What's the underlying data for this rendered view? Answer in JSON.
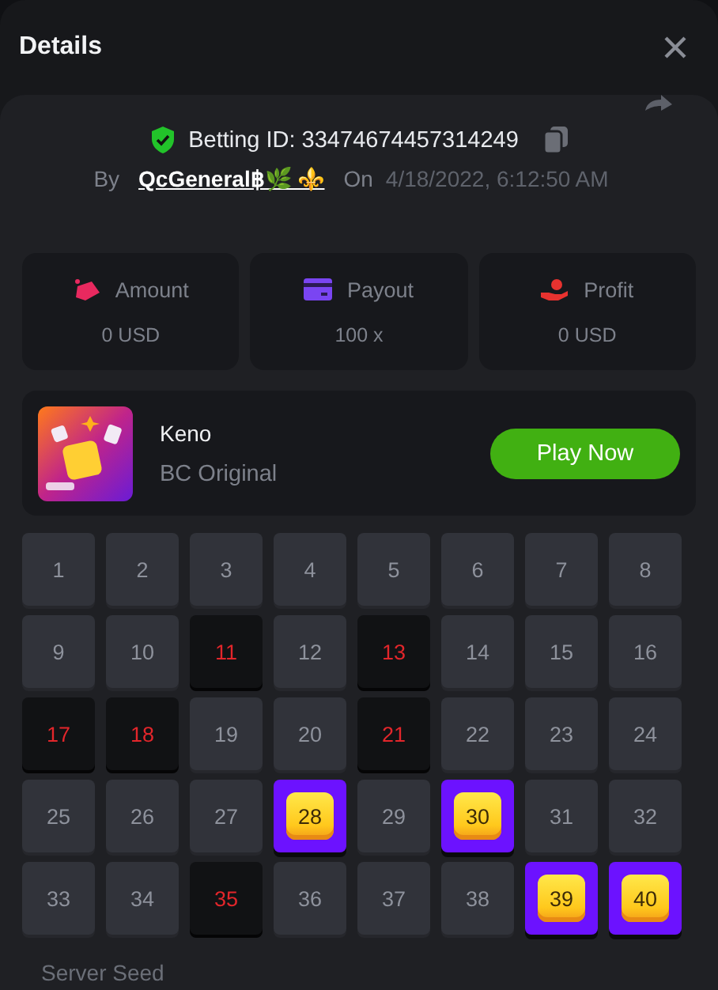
{
  "dialog": {
    "title": "Details"
  },
  "bet": {
    "betting_id": "Betting ID: 33474674457314249",
    "by_label": "By",
    "user": "QcGeneral฿🌿 ⚜️",
    "on_label": "On",
    "date": "4/18/2022, 6:12:50 AM"
  },
  "stats": [
    {
      "kind": "amount",
      "label": "Amount",
      "value": "0 USD"
    },
    {
      "kind": "payout",
      "label": "Payout",
      "value": "100 x"
    },
    {
      "kind": "profit",
      "label": "Profit",
      "value": "0 USD"
    }
  ],
  "game": {
    "name": "Keno",
    "provider": "BC Original",
    "button": "Play Now"
  },
  "cells": [
    {
      "number": "1",
      "kind": "normal"
    },
    {
      "number": "2",
      "kind": "normal"
    },
    {
      "number": "3",
      "kind": "normal"
    },
    {
      "number": "4",
      "kind": "normal"
    },
    {
      "number": "5",
      "kind": "normal"
    },
    {
      "number": "6",
      "kind": "normal"
    },
    {
      "number": "7",
      "kind": "normal"
    },
    {
      "number": "8",
      "kind": "normal"
    },
    {
      "number": "9",
      "kind": "normal"
    },
    {
      "number": "10",
      "kind": "normal"
    },
    {
      "number": "11",
      "kind": "miss"
    },
    {
      "number": "12",
      "kind": "normal"
    },
    {
      "number": "13",
      "kind": "miss"
    },
    {
      "number": "14",
      "kind": "normal"
    },
    {
      "number": "15",
      "kind": "normal"
    },
    {
      "number": "16",
      "kind": "normal"
    },
    {
      "number": "17",
      "kind": "miss"
    },
    {
      "number": "18",
      "kind": "miss"
    },
    {
      "number": "19",
      "kind": "normal"
    },
    {
      "number": "20",
      "kind": "normal"
    },
    {
      "number": "21",
      "kind": "miss"
    },
    {
      "number": "22",
      "kind": "normal"
    },
    {
      "number": "23",
      "kind": "normal"
    },
    {
      "number": "24",
      "kind": "normal"
    },
    {
      "number": "25",
      "kind": "normal"
    },
    {
      "number": "26",
      "kind": "normal"
    },
    {
      "number": "27",
      "kind": "normal"
    },
    {
      "number": "28",
      "kind": "hit"
    },
    {
      "number": "29",
      "kind": "normal"
    },
    {
      "number": "30",
      "kind": "hit"
    },
    {
      "number": "31",
      "kind": "normal"
    },
    {
      "number": "32",
      "kind": "normal"
    },
    {
      "number": "33",
      "kind": "normal"
    },
    {
      "number": "34",
      "kind": "normal"
    },
    {
      "number": "35",
      "kind": "miss"
    },
    {
      "number": "36",
      "kind": "normal"
    },
    {
      "number": "37",
      "kind": "normal"
    },
    {
      "number": "38",
      "kind": "normal"
    },
    {
      "number": "39",
      "kind": "hit"
    },
    {
      "number": "40",
      "kind": "hit"
    }
  ],
  "footer": {
    "label": "Server Seed"
  }
}
